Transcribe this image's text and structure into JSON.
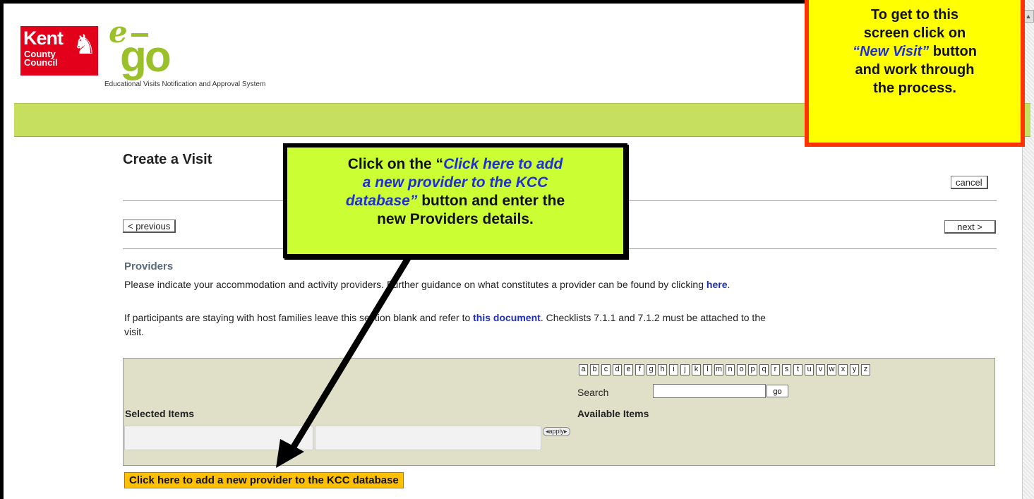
{
  "header": {
    "kent_logo": {
      "line1": "Kent",
      "line2": "County",
      "line3": "Council"
    },
    "ego_logo": {
      "text_e": "e",
      "text_go": "go"
    },
    "tagline": "Educational Visits Notification and Approval System"
  },
  "page": {
    "title": "Create a Visit",
    "cancel_label": "cancel",
    "previous_label": "< previous",
    "next_label": "next >"
  },
  "providers": {
    "heading": "Providers",
    "para1_text": "Please indicate your accommodation and activity providers. Further guidance on what constitutes a provider can be found by clicking ",
    "para1_link": "here",
    "para1_end": ".",
    "para2_text": "If participants are staying with host families leave this section blank and refer to ",
    "para2_link": "this document",
    "para2_end": ". Checklists 7.1.1 and 7.1.2 must be attached to the",
    "para2_line2": "visit."
  },
  "picker": {
    "letters": [
      "a",
      "b",
      "c",
      "d",
      "e",
      "f",
      "g",
      "h",
      "i",
      "j",
      "k",
      "l",
      "m",
      "n",
      "o",
      "p",
      "q",
      "r",
      "s",
      "t",
      "u",
      "v",
      "w",
      "x",
      "y",
      "z"
    ],
    "search_label": "Search",
    "search_value": "",
    "go_label": "go",
    "selected_label": "Selected Items",
    "available_label": "Available Items",
    "apply_label": "◂apply▸"
  },
  "add_provider_label": "Click here to add a new provider to the KCC database",
  "callout_main": {
    "line1_a": "Click on the “",
    "line1_b": "Click here to add",
    "line2": "a new provider to the KCC",
    "line3_a": "database”",
    "line3_b": " button and enter the",
    "line4": "new Providers details."
  },
  "callout_top": {
    "line1": "To get to this",
    "line2": "screen click on",
    "line3_a": "“New Visit”",
    "line3_b": " button",
    "line4": "and work through",
    "line5": "the process."
  },
  "colors": {
    "accent_green": "#c6df5e",
    "callout_green": "#ccff33",
    "callout_yellow": "#ffff00",
    "callout_border": "#ff3300",
    "add_button": "#ffc000",
    "link_blue": "#1f2fb5"
  }
}
